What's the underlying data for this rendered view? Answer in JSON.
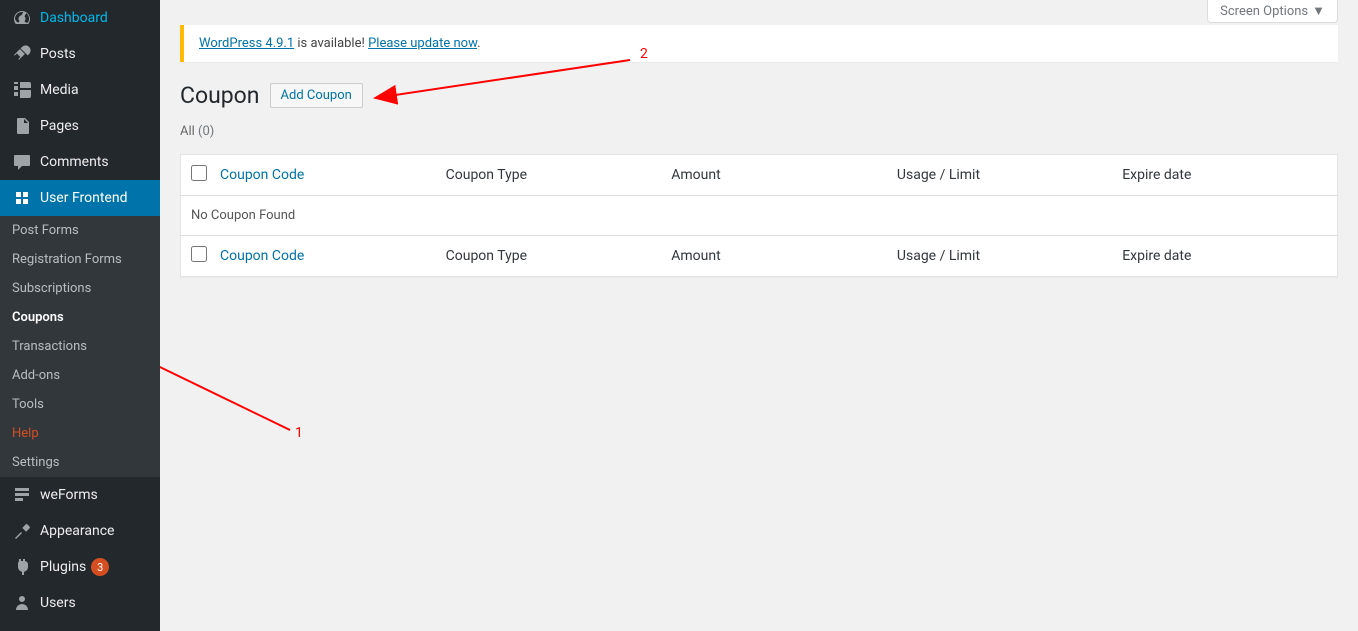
{
  "sidebar": {
    "main_items": [
      {
        "label": "Dashboard",
        "icon": "dashboard"
      },
      {
        "label": "Posts",
        "icon": "pin"
      },
      {
        "label": "Media",
        "icon": "media"
      },
      {
        "label": "Pages",
        "icon": "pages"
      },
      {
        "label": "Comments",
        "icon": "comments"
      },
      {
        "label": "User Frontend",
        "icon": "user-frontend",
        "active": true
      },
      {
        "label": "weForms",
        "icon": "weforms"
      },
      {
        "label": "Appearance",
        "icon": "appearance"
      },
      {
        "label": "Plugins",
        "icon": "plugins",
        "count": "3"
      },
      {
        "label": "Users",
        "icon": "users"
      }
    ],
    "submenu": [
      {
        "label": "Post Forms"
      },
      {
        "label": "Registration Forms"
      },
      {
        "label": "Subscriptions"
      },
      {
        "label": "Coupons",
        "current": true
      },
      {
        "label": "Transactions"
      },
      {
        "label": "Add-ons"
      },
      {
        "label": "Tools"
      },
      {
        "label": "Help",
        "help": true
      },
      {
        "label": "Settings"
      }
    ]
  },
  "screen_options": "Screen Options",
  "notice": {
    "link1": "WordPress 4.9.1",
    "text1": " is available! ",
    "link2": "Please update now",
    "period": "."
  },
  "page": {
    "title": "Coupon",
    "add_button": "Add Coupon"
  },
  "filter": {
    "all_label": "All",
    "all_count": "(0)"
  },
  "table": {
    "headers": {
      "coupon_code": "Coupon Code",
      "coupon_type": "Coupon Type",
      "amount": "Amount",
      "usage_limit": "Usage / Limit",
      "expire_date": "Expire date"
    },
    "empty": "No Coupon Found"
  },
  "annotations": {
    "label1": "1",
    "label2": "2"
  }
}
